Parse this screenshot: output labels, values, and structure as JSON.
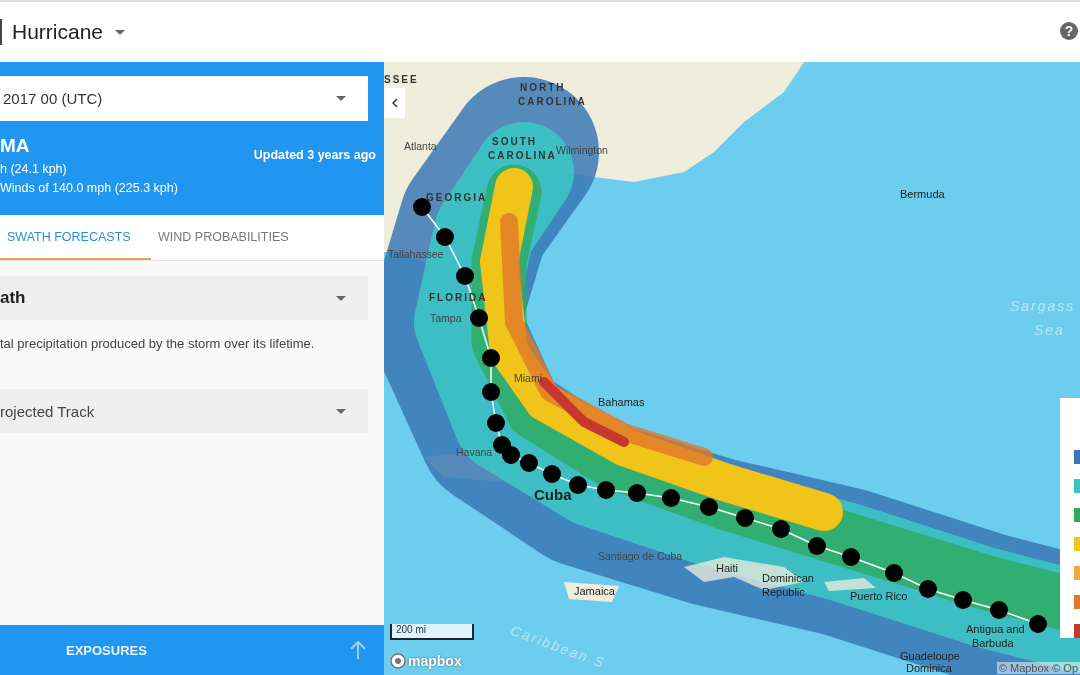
{
  "header": {
    "title": "Hurricane",
    "help": "?"
  },
  "storm": {
    "date_select": "2017 00 (UTC)",
    "name": "MA",
    "speed": "h (24.1 kph)",
    "winds": "Winds of 140.0 mph (225.3 kph)",
    "updated": "Updated 3 years ago"
  },
  "tabs": [
    {
      "label": "SWATH FORECASTS",
      "selected": true
    },
    {
      "label": "WIND PROBABILITIES",
      "selected": false
    }
  ],
  "layer_select": "ath",
  "description": "tal precipitation produced by the storm over its lifetime.",
  "track_select": "rojected Track",
  "bottom_bar": {
    "label": "EXPOSURES"
  },
  "map": {
    "labels": [
      {
        "text": "SSEE",
        "kind": "state"
      },
      {
        "text": "NORTH",
        "kind": "state"
      },
      {
        "text": "CAROLINA",
        "kind": "state"
      },
      {
        "text": "SOUTH",
        "kind": "state"
      },
      {
        "text": "CAROLINA",
        "kind": "state"
      },
      {
        "text": "Atlanta",
        "kind": "city"
      },
      {
        "text": "Wilmington",
        "kind": "city"
      },
      {
        "text": "GEORGIA",
        "kind": "state"
      },
      {
        "text": "Tallahassee",
        "kind": "city"
      },
      {
        "text": "FLORIDA",
        "kind": "state"
      },
      {
        "text": "Tampa",
        "kind": "city"
      },
      {
        "text": "Miami",
        "kind": "city"
      },
      {
        "text": "Bermuda",
        "kind": "country"
      },
      {
        "text": "Sargass",
        "kind": "water"
      },
      {
        "text": "Sea",
        "kind": "water"
      },
      {
        "text": "Bahamas",
        "kind": "country"
      },
      {
        "text": "Havana",
        "kind": "city"
      },
      {
        "text": "Cuba",
        "kind": "big"
      },
      {
        "text": "Santiago de Cuba",
        "kind": "city"
      },
      {
        "text": "Jamaica",
        "kind": "country"
      },
      {
        "text": "Haiti",
        "kind": "country"
      },
      {
        "text": "Dominican",
        "kind": "country"
      },
      {
        "text": "Republic",
        "kind": "country"
      },
      {
        "text": "Puerto Rico",
        "kind": "country"
      },
      {
        "text": "Antigua and",
        "kind": "country"
      },
      {
        "text": "Barbuda",
        "kind": "country"
      },
      {
        "text": "Guadeloupe",
        "kind": "country"
      },
      {
        "text": "Dominica",
        "kind": "country"
      },
      {
        "text": "Caribbean S",
        "kind": "water"
      }
    ],
    "scale": "200 mi",
    "logo": "mapbox",
    "attribution": "© Mapbox © Op"
  },
  "legend": {
    "items": [
      {
        "color": "#3a78b5"
      },
      {
        "color": "#3cc4c4"
      },
      {
        "color": "#2eaa5c"
      },
      {
        "color": "#f0c419"
      },
      {
        "color": "#f0a93c"
      },
      {
        "color": "#e0782a"
      },
      {
        "color": "#c8372d"
      }
    ]
  }
}
